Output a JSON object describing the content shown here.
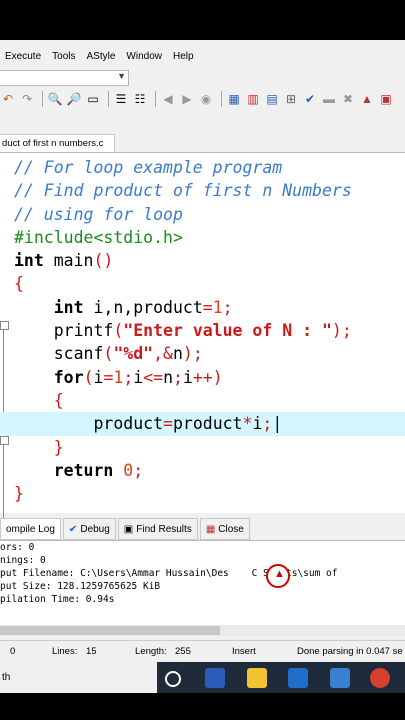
{
  "menu": [
    "Execute",
    "Tools",
    "AStyle",
    "Window",
    "Help"
  ],
  "file_tab": "duct of first n numbers.c",
  "code_lines": [
    [
      {
        "t": "// For loop example program",
        "c": "cmt"
      }
    ],
    [
      {
        "t": "// Find product of first n Numbers",
        "c": "cmt"
      }
    ],
    [
      {
        "t": "// using for loop",
        "c": "cmt"
      }
    ],
    [
      {
        "t": "#include<stdio.h>",
        "c": "pp"
      }
    ],
    [
      {
        "t": "int",
        "c": "kw"
      },
      {
        "t": " main",
        "c": "id"
      },
      {
        "t": "()",
        "c": "op"
      }
    ],
    [
      {
        "t": "{",
        "c": "op"
      }
    ],
    [
      {
        "t": "    ",
        "c": "id"
      },
      {
        "t": "int",
        "c": "kw"
      },
      {
        "t": " i,n,product",
        "c": "id"
      },
      {
        "t": "=",
        "c": "op"
      },
      {
        "t": "1",
        "c": "num"
      },
      {
        "t": ";",
        "c": "op"
      }
    ],
    [
      {
        "t": "    printf",
        "c": "id"
      },
      {
        "t": "(",
        "c": "op"
      },
      {
        "t": "\"Enter value of N : \"",
        "c": "str"
      },
      {
        "t": ");",
        "c": "op"
      }
    ],
    [
      {
        "t": "    scanf",
        "c": "id"
      },
      {
        "t": "(",
        "c": "op"
      },
      {
        "t": "\"%d\"",
        "c": "str"
      },
      {
        "t": ",&",
        "c": "op"
      },
      {
        "t": "n",
        "c": "id"
      },
      {
        "t": ");",
        "c": "op"
      }
    ],
    [
      {
        "t": "    ",
        "c": "id"
      },
      {
        "t": "for",
        "c": "kw"
      },
      {
        "t": "(",
        "c": "op"
      },
      {
        "t": "i",
        "c": "id"
      },
      {
        "t": "=",
        "c": "op"
      },
      {
        "t": "1",
        "c": "num"
      },
      {
        "t": ";",
        "c": "op"
      },
      {
        "t": "i",
        "c": "id"
      },
      {
        "t": "<=",
        "c": "op"
      },
      {
        "t": "n",
        "c": "id"
      },
      {
        "t": ";",
        "c": "op"
      },
      {
        "t": "i",
        "c": "id"
      },
      {
        "t": "++)",
        "c": "op"
      }
    ],
    [
      {
        "t": "    {",
        "c": "op"
      }
    ],
    [
      {
        "t": "        product",
        "c": "id"
      },
      {
        "t": "=",
        "c": "op"
      },
      {
        "t": "product",
        "c": "id"
      },
      {
        "t": "*",
        "c": "op"
      },
      {
        "t": "i",
        "c": "id"
      },
      {
        "t": ";",
        "c": "op"
      },
      {
        "t": "|",
        "c": "id"
      }
    ],
    [
      {
        "t": "    }",
        "c": "op"
      }
    ],
    [
      {
        "t": "    ",
        "c": "id"
      },
      {
        "t": "return",
        "c": "kw"
      },
      {
        "t": " ",
        "c": "id"
      },
      {
        "t": "0",
        "c": "num"
      },
      {
        "t": ";",
        "c": "op"
      }
    ],
    [
      {
        "t": "}",
        "c": "op"
      }
    ]
  ],
  "highlight_line_index": 11,
  "bottom_tabs": [
    "ompile Log",
    "Debug",
    "Find Results",
    "Close"
  ],
  "log_lines": [
    "ors: 0",
    "nings: 0",
    "put Filename: C:\\Users\\Ammar Hussain\\Des    C Shorts\\sum of",
    "put Size: 128.1259765625 KiB",
    "pilation Time: 0.94s"
  ],
  "status": {
    "col": "0",
    "lines_label": "Lines:",
    "lines": "15",
    "length_label": "Length:",
    "length": "255",
    "mode": "Insert",
    "message": "Done parsing in 0.047 se"
  },
  "taskbar_left": "th",
  "colors": {
    "highlight": "#d4f7ff",
    "comment": "#3b7bcd",
    "string": "#cc1a1a",
    "preprocessor": "#1a8c1a"
  }
}
